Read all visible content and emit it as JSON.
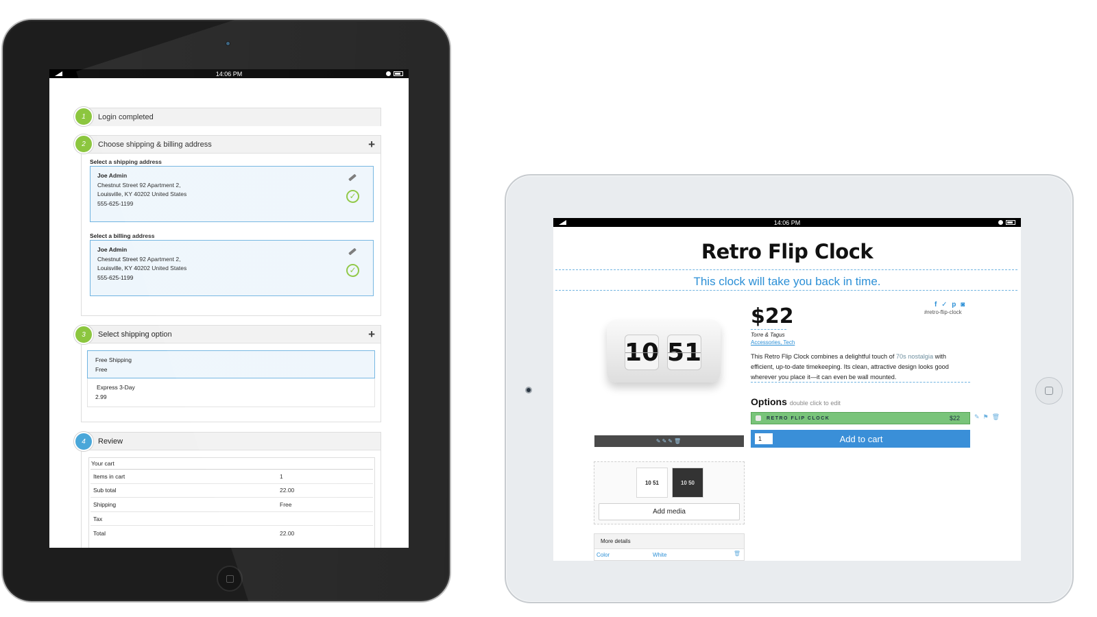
{
  "status_bar": {
    "time": "14:06 PM"
  },
  "checkout": {
    "steps": [
      {
        "number": "1",
        "title": "Login completed"
      },
      {
        "number": "2",
        "title": "Choose shipping & billing address"
      },
      {
        "number": "3",
        "title": "Select shipping option"
      },
      {
        "number": "4",
        "title": "Review"
      }
    ],
    "shipping_address": {
      "label": "Select a shipping address",
      "name": "Joe Admin",
      "line1": "Chestnut Street 92 Apartment 2,",
      "line2": "Louisville, KY 40202 United States",
      "phone": "555-625-1199"
    },
    "billing_address": {
      "label": "Select a billing address",
      "name": "Joe Admin",
      "line1": "Chestnut Street 92 Apartment 2,",
      "line2": "Louisville, KY 40202 United States",
      "phone": "555-625-1199"
    },
    "shipping_options": [
      {
        "name": "Free Shipping",
        "price": "Free"
      },
      {
        "name": "Express 3-Day",
        "price": "2.99"
      }
    ],
    "cart": {
      "heading": "Your cart",
      "rows": [
        {
          "label": "Items in cart",
          "value": "1"
        },
        {
          "label": "Sub total",
          "value": "22.00"
        },
        {
          "label": "Shipping",
          "value": "Free"
        },
        {
          "label": "Tax",
          "value": ""
        },
        {
          "label": "Total",
          "value": "22.00"
        }
      ]
    }
  },
  "product": {
    "title": "Retro Flip Clock",
    "subtitle": "This clock will take you back in time.",
    "price": "$22",
    "brand": "Torre & Tagus",
    "categories": "Accessories, Tech",
    "social_icons": "f ✓ p ◙",
    "hashtag": "#retro-flip-clock",
    "description_parts": {
      "p1": "This Retro Flip Clock combines a delightful touch of ",
      "highlight": "70s nostalgia",
      "p2": " with efficient, up-to-date timekeeping. Its clean, attractive design looks good wherever you place it—it can even be wall mounted."
    },
    "clock_digits": {
      "hours": "10",
      "minutes": "51"
    },
    "thumb_labels": [
      "10 51",
      "10 50"
    ],
    "options_label": "Options",
    "options_hint": "double click to edit",
    "option_name": "RETRO FLIP CLOCK",
    "option_price": "$22",
    "quantity": "1",
    "add_to_cart": "Add to cart",
    "add_media": "Add media",
    "image_toolbar_icons": "✎✎✎🗑",
    "more_details": {
      "heading": "More details",
      "key": "Color",
      "value": "White"
    }
  },
  "colors": {
    "step_green": "#8cc63f",
    "step_blue": "#4aa7d9",
    "accent_blue": "#2b8fd6",
    "option_green": "#79c47a",
    "cart_button": "#3a8fd8"
  }
}
